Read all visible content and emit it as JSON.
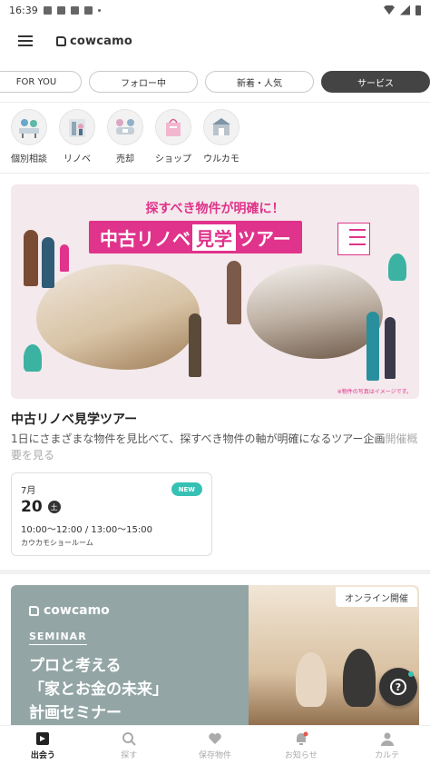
{
  "status_bar": {
    "time": "16:39"
  },
  "header": {
    "brand": "cowcamo"
  },
  "tabs": [
    {
      "label": "FOR YOU"
    },
    {
      "label": "フォロー中"
    },
    {
      "label": "新着・人気"
    },
    {
      "label": "サービス",
      "active": true
    }
  ],
  "categories": [
    {
      "label": "個別相談",
      "icon": "consultation-icon"
    },
    {
      "label": "リノベ",
      "icon": "renovation-icon"
    },
    {
      "label": "売却",
      "icon": "sale-icon"
    },
    {
      "label": "ショップ",
      "icon": "shop-icon"
    },
    {
      "label": "ウルカモ",
      "icon": "urukamo-icon"
    }
  ],
  "event": {
    "banner": {
      "headline": "探すべき物件が明確に！",
      "title_prefix": "中古リノベ",
      "title_highlight": "見学",
      "title_suffix": "ツアー",
      "note": "※物件の写真はイメージです。"
    },
    "title": "中古リノベ見学ツアー",
    "description": "1日にさまざまな物件を見比べて、探すべき物件の軸が明確になるツアー企画",
    "description_more": "開催概要を見る",
    "date": {
      "month": "7月",
      "day": "20",
      "weekday": "土",
      "time": "10:00〜12:00 / 13:00〜15:00",
      "place": "カウカモショールーム",
      "badge": "NEW"
    }
  },
  "seminar": {
    "brand": "cowcamo",
    "label": "SEMINAR",
    "title": "プロと考える\n「家とお金の未来」\n計画セミナー",
    "online_badge": "オンライン開催"
  },
  "bottom_nav": [
    {
      "label": "出会う",
      "active": true
    },
    {
      "label": "探す"
    },
    {
      "label": "保存物件"
    },
    {
      "label": "お知らせ"
    },
    {
      "label": "カルテ"
    }
  ],
  "colors": {
    "accent_pink": "#e0338b",
    "badge_teal": "#36c1b4",
    "dark": "#444444"
  }
}
